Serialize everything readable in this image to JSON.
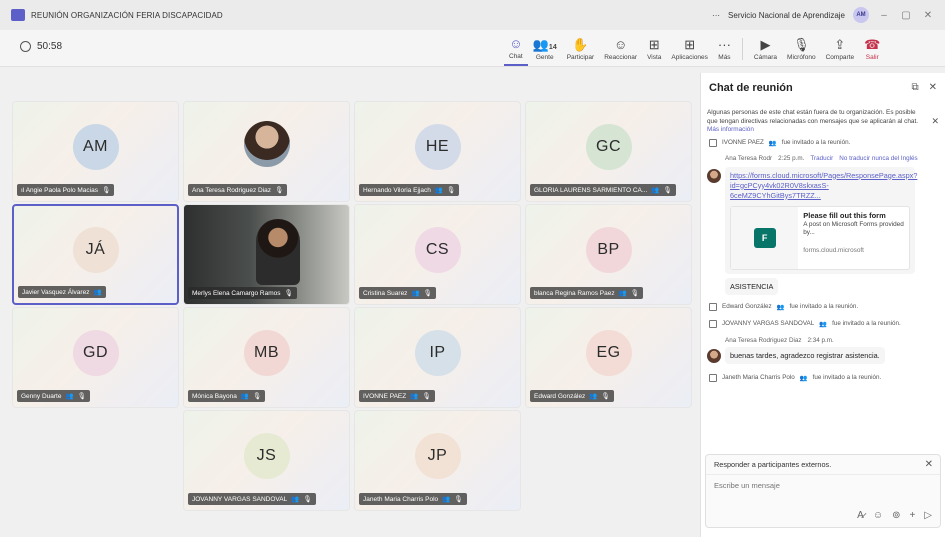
{
  "window": {
    "title": "REUNIÓN ORGANIZACIÓN FERIA DISCAPACIDAD",
    "more": "···",
    "org": "Servicio Nacional de Aprendizaje",
    "user_initials": "AM",
    "minimize": "–",
    "maximize": "▢",
    "close": "✕"
  },
  "toolbar": {
    "timer": "50:58",
    "items": [
      {
        "label": "Chat",
        "icon": "☺"
      },
      {
        "label": "Gente",
        "icon": "👥",
        "count": "14"
      },
      {
        "label": "Participar",
        "icon": "✋"
      },
      {
        "label": "Reaccionar",
        "icon": "☺"
      },
      {
        "label": "Vista",
        "icon": "⊞"
      },
      {
        "label": "Aplicaciones",
        "icon": "⊞"
      },
      {
        "label": "Más",
        "icon": "···"
      },
      {
        "label": "Cámara",
        "icon": "▶"
      },
      {
        "label": "Micrófono",
        "icon": "🎙"
      },
      {
        "label": "Comparte",
        "icon": "⇪"
      },
      {
        "label": "Salir",
        "icon": "☎"
      }
    ]
  },
  "tiles": [
    {
      "initials": "AM",
      "name": "Angie Paola Polo Macias",
      "circle": "#c9d7e6"
    },
    {
      "initials": "",
      "name": "Ana Teresa Rodriguez Diaz",
      "circle": ""
    },
    {
      "initials": "HE",
      "name": "Hernando Viloria Ejjach",
      "circle": "#d3dbe9"
    },
    {
      "initials": "GC",
      "name": "GLORIA LAURENS SARMIENTO CA...",
      "circle": "#d5e4d3"
    },
    {
      "initials": "JÁ",
      "name": "Javier Vasquez Álvarez",
      "circle": "#f0e1d6"
    },
    {
      "initials": "",
      "name": "Merlys Elena Camargo Ramos",
      "circle": ""
    },
    {
      "initials": "CS",
      "name": "Cristina Suarez",
      "circle": "#eed9e4"
    },
    {
      "initials": "BP",
      "name": "blanca Regina Ramos Paez",
      "circle": "#f1d7da"
    },
    {
      "initials": "GD",
      "name": "Genny Duarte",
      "circle": "#efd9e2"
    },
    {
      "initials": "MB",
      "name": "Mónica Bayona",
      "circle": "#f2d8d4"
    },
    {
      "initials": "IP",
      "name": "IVONNE PAEZ",
      "circle": "#d6e0e9"
    },
    {
      "initials": "EG",
      "name": "Edward González",
      "circle": "#f3dcd6"
    },
    {
      "initials": "JS",
      "name": "JOVANNY VARGAS SANDOVAL",
      "circle": "#e6ead2"
    },
    {
      "initials": "JP",
      "name": "Janeth Maria Charris Polo",
      "circle": "#f2e2d5"
    }
  ],
  "chat": {
    "title": "Chat de reunión",
    "notice": "Algunas personas de este chat están fuera de tu organización. Es posible que tengan directivas relacionadas con mensajes que se aplicarán al chat.",
    "notice_link": "Más información",
    "sys1_name": "IVONNE PAEZ",
    "sys_invited": "fue invitado a la reunión.",
    "meta1_author": "Ana Teresa Rodr",
    "meta1_time": "2:25 p.m.",
    "translate": "Traducir",
    "no_translate": "No traducir nunca del Inglés",
    "link_text": "https://forms.cloud.microsoft/Pages/ResponsePage.aspx?id=gcPCyy4vk02R0V8skxasS-6ceMZ9CYhGitBys7TRZZ...",
    "card_title": "Please fill out this form",
    "card_desc": "A post on Microsoft Forms provided by...",
    "card_src": "forms.cloud.microsoft",
    "asistencia": "ASISTENCIA",
    "sys2_name": "Edward González",
    "sys3_name": "JOVANNY VARGAS SANDOVAL",
    "meta2_author": "Ana Teresa Rodriguez Diaz",
    "meta2_time": "2:34 p.m.",
    "msg2": "buenas tardes, agradezco registrar asistencia.",
    "sys4_name": "Janeth Maria Charris Polo",
    "reply_title": "Responder a participantes externos.",
    "input_placeholder": "Escribe un mensaje"
  }
}
